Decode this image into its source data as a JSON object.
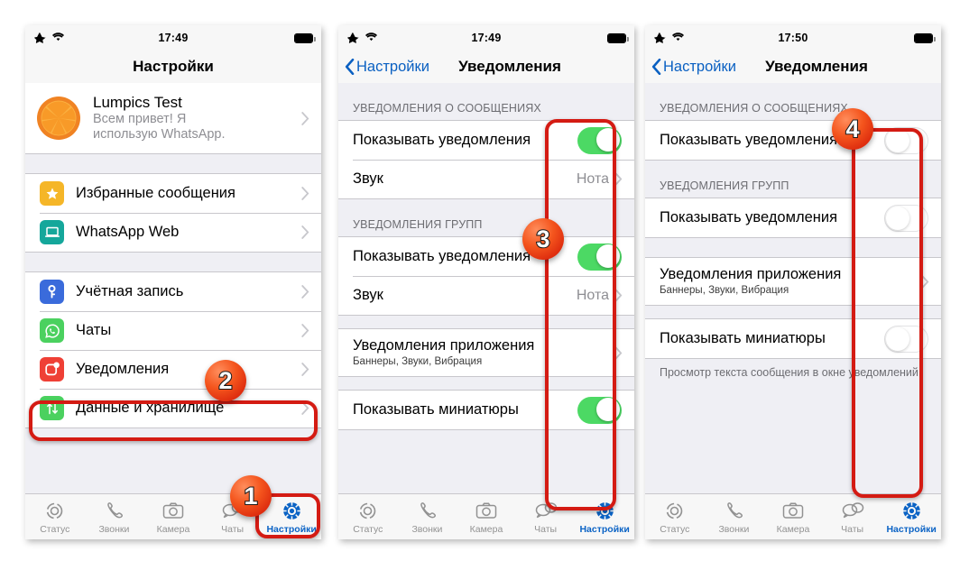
{
  "phones": [
    {
      "id": "phone-1",
      "statusbar": {
        "time": "17:49",
        "airplane_icon": "airplane-mode-icon",
        "wifi_icon": "wifi-icon",
        "battery_icon": "battery-full-icon"
      },
      "navbar": {
        "title": "Настройки"
      },
      "profile": {
        "name": "Lumpics Test",
        "status_line1": "Всем привет! Я",
        "status_line2": "использую WhatsApp.",
        "avatar_icon": "orange-slice-avatar"
      },
      "groups": [
        {
          "rows": [
            {
              "label": "Избранные сообщения",
              "icon": "star-icon",
              "icon_color": "#f5b628"
            },
            {
              "label": "WhatsApp Web",
              "icon": "laptop-icon",
              "icon_color": "#15a79b"
            }
          ]
        },
        {
          "rows": [
            {
              "label": "Учётная запись",
              "icon": "key-icon",
              "icon_color": "#3a6bdb"
            },
            {
              "label": "Чаты",
              "icon": "whatsapp-icon",
              "icon_color": "#4bd15f"
            },
            {
              "label": "Уведомления",
              "icon": "notification-badge-icon",
              "icon_color": "#ef4036"
            },
            {
              "label": "Данные и хранилище",
              "icon": "arrows-updown-icon",
              "icon_color": "#4bd15f"
            }
          ]
        }
      ]
    },
    {
      "id": "phone-2",
      "statusbar": {
        "time": "17:49"
      },
      "navbar": {
        "back_label": "Настройки",
        "title": "Уведомления"
      },
      "sections": [
        {
          "header": "УВЕДОМЛЕНИЯ О СООБЩЕНИЯХ",
          "rows": [
            {
              "label": "Показывать уведомления",
              "control": "toggle",
              "state": "on"
            },
            {
              "label": "Звук",
              "control": "value",
              "value": "Нота"
            }
          ]
        },
        {
          "header": "УВЕДОМЛЕНИЯ ГРУПП",
          "rows": [
            {
              "label": "Показывать уведомления",
              "control": "toggle",
              "state": "on"
            },
            {
              "label": "Звук",
              "control": "value",
              "value": "Нота"
            }
          ]
        },
        {
          "header": "",
          "rows": [
            {
              "label": "Уведомления приложения",
              "sub": "Баннеры, Звуки, Вибрация",
              "control": "chevron"
            }
          ]
        },
        {
          "header": "",
          "rows": [
            {
              "label": "Показывать миниатюры",
              "control": "toggle",
              "state": "on"
            }
          ]
        }
      ]
    },
    {
      "id": "phone-3",
      "statusbar": {
        "time": "17:50"
      },
      "navbar": {
        "back_label": "Настройки",
        "title": "Уведомления"
      },
      "sections": [
        {
          "header": "УВЕДОМЛЕНИЯ О СООБЩЕНИЯХ",
          "rows": [
            {
              "label": "Показывать уведомления",
              "control": "toggle",
              "state": "off"
            }
          ]
        },
        {
          "header": "УВЕДОМЛЕНИЯ ГРУПП",
          "rows": [
            {
              "label": "Показывать уведомления",
              "control": "toggle",
              "state": "off"
            }
          ]
        },
        {
          "header": "",
          "rows": [
            {
              "label": "Уведомления приложения",
              "sub": "Баннеры, Звуки, Вибрация",
              "control": "chevron"
            }
          ]
        },
        {
          "header": "",
          "rows": [
            {
              "label": "Показывать миниатюры",
              "control": "toggle",
              "state": "off"
            }
          ]
        }
      ],
      "footnote": "Просмотр текста сообщения в окне уведомлений."
    }
  ],
  "tabbar": {
    "tabs": [
      {
        "label": "Статус",
        "icon": "status-ring-icon",
        "active": false
      },
      {
        "label": "Звонки",
        "icon": "phone-handset-icon",
        "active": false
      },
      {
        "label": "Камера",
        "icon": "camera-icon",
        "active": false
      },
      {
        "label": "Чаты",
        "icon": "speech-bubbles-icon",
        "active": false
      },
      {
        "label": "Настройки",
        "icon": "gear-icon",
        "active": true
      }
    ]
  },
  "annotations": {
    "badges": [
      {
        "number": "1",
        "target": "settings-tab"
      },
      {
        "number": "2",
        "target": "notifications-menu-row"
      },
      {
        "number": "3",
        "target": "toggles-column-on"
      },
      {
        "number": "4",
        "target": "toggles-column-off"
      }
    ]
  },
  "colors": {
    "accent_blue": "#0b63c5",
    "toggle_on_green": "#4cd964",
    "highlight_red": "#d41b13",
    "section_bg": "#efeff4"
  }
}
